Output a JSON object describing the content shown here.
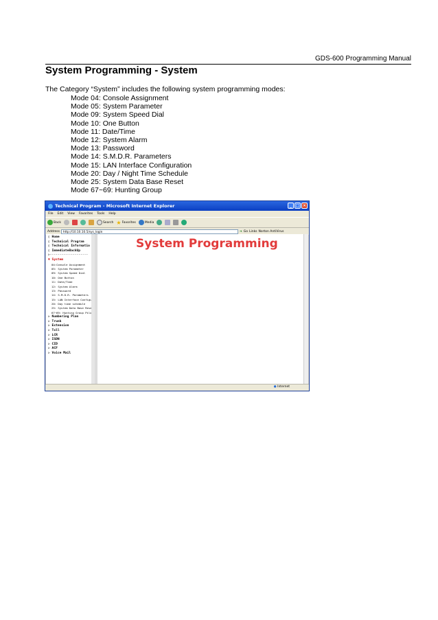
{
  "header": {
    "manual": "GDS-600 Programming Manual"
  },
  "title": "System Programming - System",
  "intro": "The Category “System” includes the following system programming modes:",
  "modes": [
    "Mode 04: Console Assignment",
    "Mode 05: System Parameter",
    "Mode 09: System Speed Dial",
    "Mode 10: One Button",
    "Mode 11: Date/Time",
    "Mode 12: System Alarm",
    "Mode 13: Password",
    "Mode 14: S.M.D.R. Parameters",
    "Mode 15: LAN Interface Configuration",
    "Mode 20: Day / Night Time Schedule",
    "Mode 25: System Data Base Reset",
    "Mode 67~69: Hunting Group"
  ],
  "browser": {
    "window_title": "Technical Program - Microsoft Internet Explorer",
    "menu": [
      "File",
      "Edit",
      "View",
      "Favorites",
      "Tools",
      "Help"
    ],
    "toolbar": {
      "back": "Back",
      "search": "Search",
      "favorites": "Favorites",
      "media": "Media"
    },
    "address_label": "Address",
    "address": "http://10.10.10.5/sys_login",
    "go": "Go",
    "links": "Links",
    "norton": "Norton AntiVirus",
    "tree_top": [
      "Home",
      "Technical Program",
      "Technical Informatio",
      "ImmediateBackUp",
      "--------------------",
      "System"
    ],
    "tree_system_items": [
      "04:Console Assignment",
      "05: System Parameter",
      "09: System Speed Dial",
      "10: One Button",
      "11: Date/Time",
      "12: System Alarm",
      "13: Password",
      "14: S.M.D.R. Parameters",
      "15: LAN Interface Configura",
      "20: Day time schedule",
      "25: System Data Base Reset",
      "67~69: Hunting Group Pilot"
    ],
    "tree_bottom": [
      "Numbering Plan",
      "Trunk",
      "Extension",
      "Toll",
      "LCR",
      "ISDN",
      "CID",
      "ACF",
      "Voice Mail"
    ],
    "main_heading": "System Programming",
    "status_zone": "Internet"
  }
}
